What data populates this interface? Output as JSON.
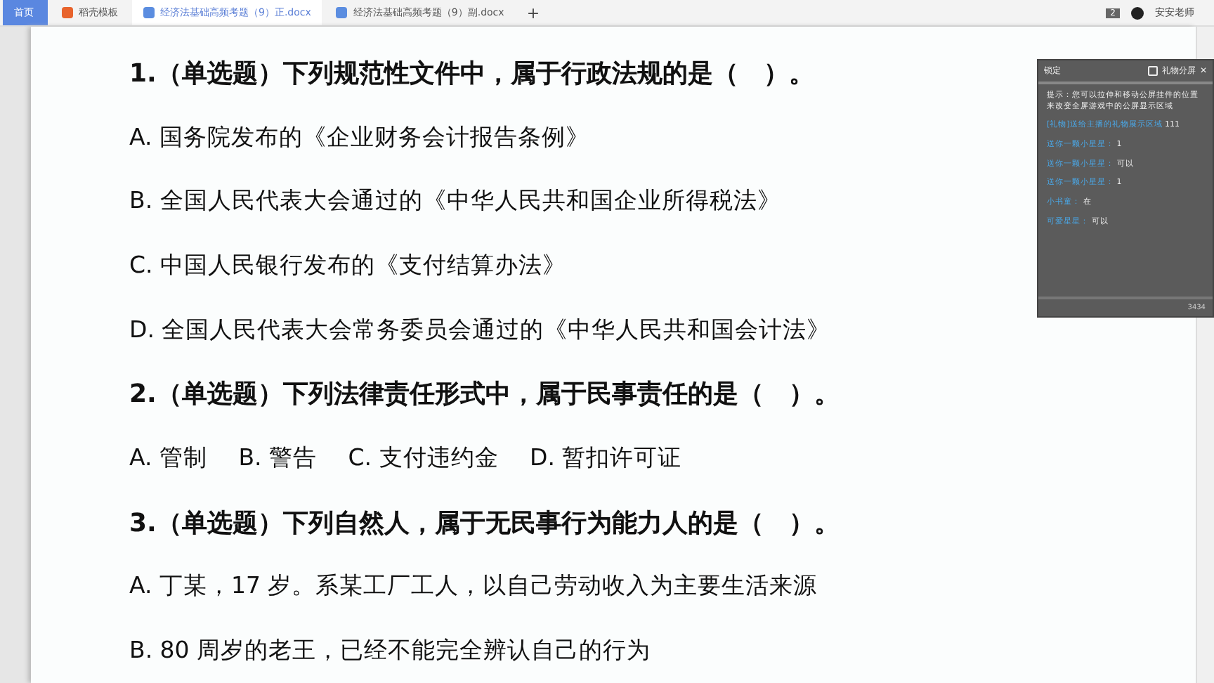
{
  "tabs": [
    {
      "label": "首页",
      "kind": "home",
      "selected": false
    },
    {
      "label": "稻壳模板",
      "kind": "template",
      "selected": false
    },
    {
      "label": "经济法基础高频考题（9）正.docx",
      "kind": "doc",
      "selected": true
    },
    {
      "label": "经济法基础高频考题（9）副.docx",
      "kind": "doc",
      "selected": false
    }
  ],
  "new_tab": "+",
  "window_badge": "2",
  "user_name": "安安老师",
  "document": {
    "lines": [
      {
        "kind": "question",
        "text": "1.（单选题）下列规范性文件中，属于行政法规的是（　）。"
      },
      {
        "kind": "option",
        "text": "A. 国务院发布的《企业财务会计报告条例》"
      },
      {
        "kind": "option",
        "text": "B. 全国人民代表大会通过的《中华人民共和国企业所得税法》"
      },
      {
        "kind": "option",
        "text": "C. 中国人民银行发布的《支付结算办法》"
      },
      {
        "kind": "option",
        "text": "D. 全国人民代表大会常务委员会通过的《中华人民共和国会计法》"
      },
      {
        "kind": "question",
        "text": "2.（单选题）下列法律责任形式中，属于民事责任的是（　）。"
      },
      {
        "kind": "option",
        "text": "A. 管制　 B. 警告　 C. 支付违约金　 D. 暂扣许可证"
      },
      {
        "kind": "question",
        "text": "3.（单选题）下列自然人，属于无民事行为能力人的是（　）。"
      },
      {
        "kind": "option",
        "text": "A. 丁某，17 岁。系某工厂工人，以自己劳动收入为主要生活来源"
      },
      {
        "kind": "option",
        "text": "B. 80 周岁的老王，已经不能完全辨认自己的行为"
      }
    ]
  },
  "overlay": {
    "lock": "锁定",
    "split": "礼物分屏",
    "close": "✕",
    "tip": "提示：您可以拉伸和移动公屏挂件的位置来改变全屏游戏中的公屏显示区域",
    "messages": [
      {
        "user": "[礼物]送给主播的礼物展示区域",
        "text": "111"
      },
      {
        "user": "送你一颗小星星：",
        "text": "1"
      },
      {
        "user": "送你一颗小星星：",
        "text": "可以"
      },
      {
        "user": "送你一颗小星星：",
        "text": "1"
      },
      {
        "user": "小书童：",
        "text": "在"
      },
      {
        "user": "可爱星星：",
        "text": "可以"
      }
    ],
    "count": "3434"
  }
}
